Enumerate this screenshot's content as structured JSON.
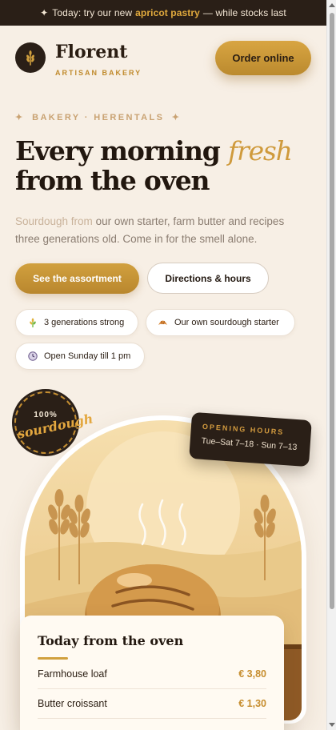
{
  "promo": {
    "prefix": "Today: try our new",
    "highlight": "apricot pastry",
    "suffix": "— while stocks last"
  },
  "brand": {
    "name": "Florent",
    "tagline": "ARTISAN BAKERY",
    "logo_icon": "wheat-icon"
  },
  "header": {
    "order_label": "Order online"
  },
  "hero": {
    "eyebrow": "BAKERY · HERENTALS",
    "title_part1": "Every morning",
    "title_accent": "fresh",
    "title_part2": "from the oven",
    "intro_lead": "Sourdough from",
    "intro_rest": "our own starter, farm butter and recipes three generations old. Come in for the smell alone.",
    "cta_primary": "See the assortment",
    "cta_secondary": "Directions & hours"
  },
  "badges": [
    {
      "icon": "wheat-icon",
      "label": "3 generations strong"
    },
    {
      "icon": "croissant-icon",
      "label": "Our own sourdough starter"
    },
    {
      "icon": "clock-icon",
      "label": "Open Sunday till 1 pm"
    }
  ],
  "sticker": {
    "top": "100%",
    "word": "sourdough"
  },
  "hours": {
    "label": "OPENING HOURS",
    "value": "Tue–Sat 7–18 · Sun 7–13"
  },
  "menu": {
    "title": "Today from the oven",
    "items": [
      {
        "name": "Farmhouse loaf",
        "price": "€ 3,80"
      },
      {
        "name": "Butter croissant",
        "price": "€ 1,30"
      }
    ]
  },
  "colors": {
    "accent": "#d1a03e",
    "dark": "#2a1f17",
    "background": "#f7efe5"
  }
}
